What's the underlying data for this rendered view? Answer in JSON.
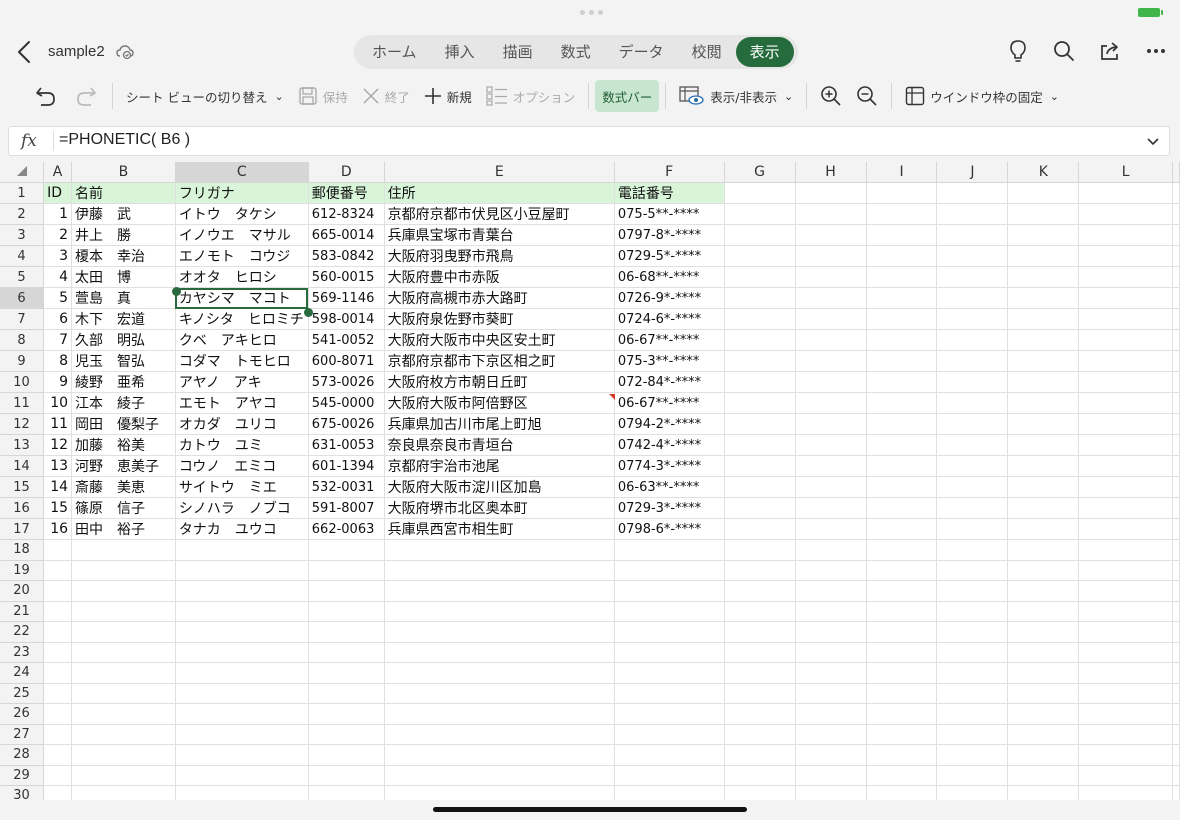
{
  "titlebar": {
    "doc_title": "sample2",
    "tabs": [
      {
        "label": "ホーム",
        "active": false
      },
      {
        "label": "挿入",
        "active": false
      },
      {
        "label": "描画",
        "active": false
      },
      {
        "label": "数式",
        "active": false
      },
      {
        "label": "データ",
        "active": false
      },
      {
        "label": "校閲",
        "active": false
      },
      {
        "label": "表示",
        "active": true
      }
    ],
    "accent_color": "#256b3c"
  },
  "ribbon": {
    "sheet_view": "シート ビューの切り替え",
    "keep": "保持",
    "exit": "終了",
    "new": "新規",
    "options": "オプション",
    "formula_bar": "数式バー",
    "show_hide": "表示/非表示",
    "freeze_panes": "ウインドウ枠の固定"
  },
  "formula_bar": {
    "fx_label": "fx",
    "formula": "=PHONETIC( B6 )"
  },
  "grid": {
    "columns": [
      "A",
      "B",
      "C",
      "D",
      "E",
      "F",
      "G",
      "H",
      "I",
      "J",
      "K",
      "L"
    ],
    "selected_column": "C",
    "selected_row": 6,
    "header_row": [
      "ID",
      "名前",
      "フリガナ",
      "郵便番号",
      "住所",
      "電話番号"
    ],
    "rows": [
      [
        "1",
        "伊藤　武",
        "イトウ　タケシ",
        "612-8324",
        "京都府京都市伏見区小豆屋町",
        "075-5**-****"
      ],
      [
        "2",
        "井上　勝",
        "イノウエ　マサル",
        "665-0014",
        "兵庫県宝塚市青葉台",
        "0797-8*-****"
      ],
      [
        "3",
        "榎本　幸治",
        "エノモト　コウジ",
        "583-0842",
        "大阪府羽曳野市飛鳥",
        "0729-5*-****"
      ],
      [
        "4",
        "太田　博",
        "オオタ　ヒロシ",
        "560-0015",
        "大阪府豊中市赤阪",
        "06-68**-****"
      ],
      [
        "5",
        "萱島　真",
        "カヤシマ　マコト",
        "569-1146",
        "大阪府高槻市赤大路町",
        "0726-9*-****"
      ],
      [
        "6",
        "木下　宏道",
        "キノシタ　ヒロミチ",
        "598-0014",
        "大阪府泉佐野市葵町",
        "0724-6*-****"
      ],
      [
        "7",
        "久部　明弘",
        "クベ　アキヒロ",
        "541-0052",
        "大阪府大阪市中央区安土町",
        "06-67**-****"
      ],
      [
        "8",
        "児玉　智弘",
        "コダマ　トモヒロ",
        "600-8071",
        "京都府京都市下京区相之町",
        "075-3**-****"
      ],
      [
        "9",
        "綾野　亜希",
        "アヤノ　アキ",
        "573-0026",
        "大阪府枚方市朝日丘町",
        "072-84*-****"
      ],
      [
        "10",
        "江本　綾子",
        "エモト　アヤコ",
        "545-0000",
        "大阪府大阪市阿倍野区",
        "06-67**-****"
      ],
      [
        "11",
        "岡田　優梨子",
        "オカダ　ユリコ",
        "675-0026",
        "兵庫県加古川市尾上町旭",
        "0794-2*-****"
      ],
      [
        "12",
        "加藤　裕美",
        "カトウ　ユミ",
        "631-0053",
        "奈良県奈良市青垣台",
        "0742-4*-****"
      ],
      [
        "13",
        "河野　恵美子",
        "コウノ　エミコ",
        "601-1394",
        "京都府宇治市池尾",
        "0774-3*-****"
      ],
      [
        "14",
        "斎藤　美恵",
        "サイトウ　ミエ",
        "532-0031",
        "大阪府大阪市淀川区加島",
        "06-63**-****"
      ],
      [
        "15",
        "篠原　信子",
        "シノハラ　ノブコ",
        "591-8007",
        "大阪府堺市北区奥本町",
        "0729-3*-****"
      ],
      [
        "16",
        "田中　裕子",
        "タナカ　ユウコ",
        "662-0063",
        "兵庫県西宮市相生町",
        "0798-6*-****"
      ]
    ],
    "row_numbers": [
      "1",
      "2",
      "3",
      "4",
      "5",
      "6",
      "7",
      "8",
      "9",
      "10",
      "11",
      "12",
      "13",
      "14",
      "15",
      "16",
      "17",
      "18",
      "19",
      "20",
      "21",
      "22",
      "23",
      "24",
      "25",
      "26",
      "27",
      "28",
      "29",
      "30"
    ],
    "header_fill": "#d9f5d9"
  }
}
